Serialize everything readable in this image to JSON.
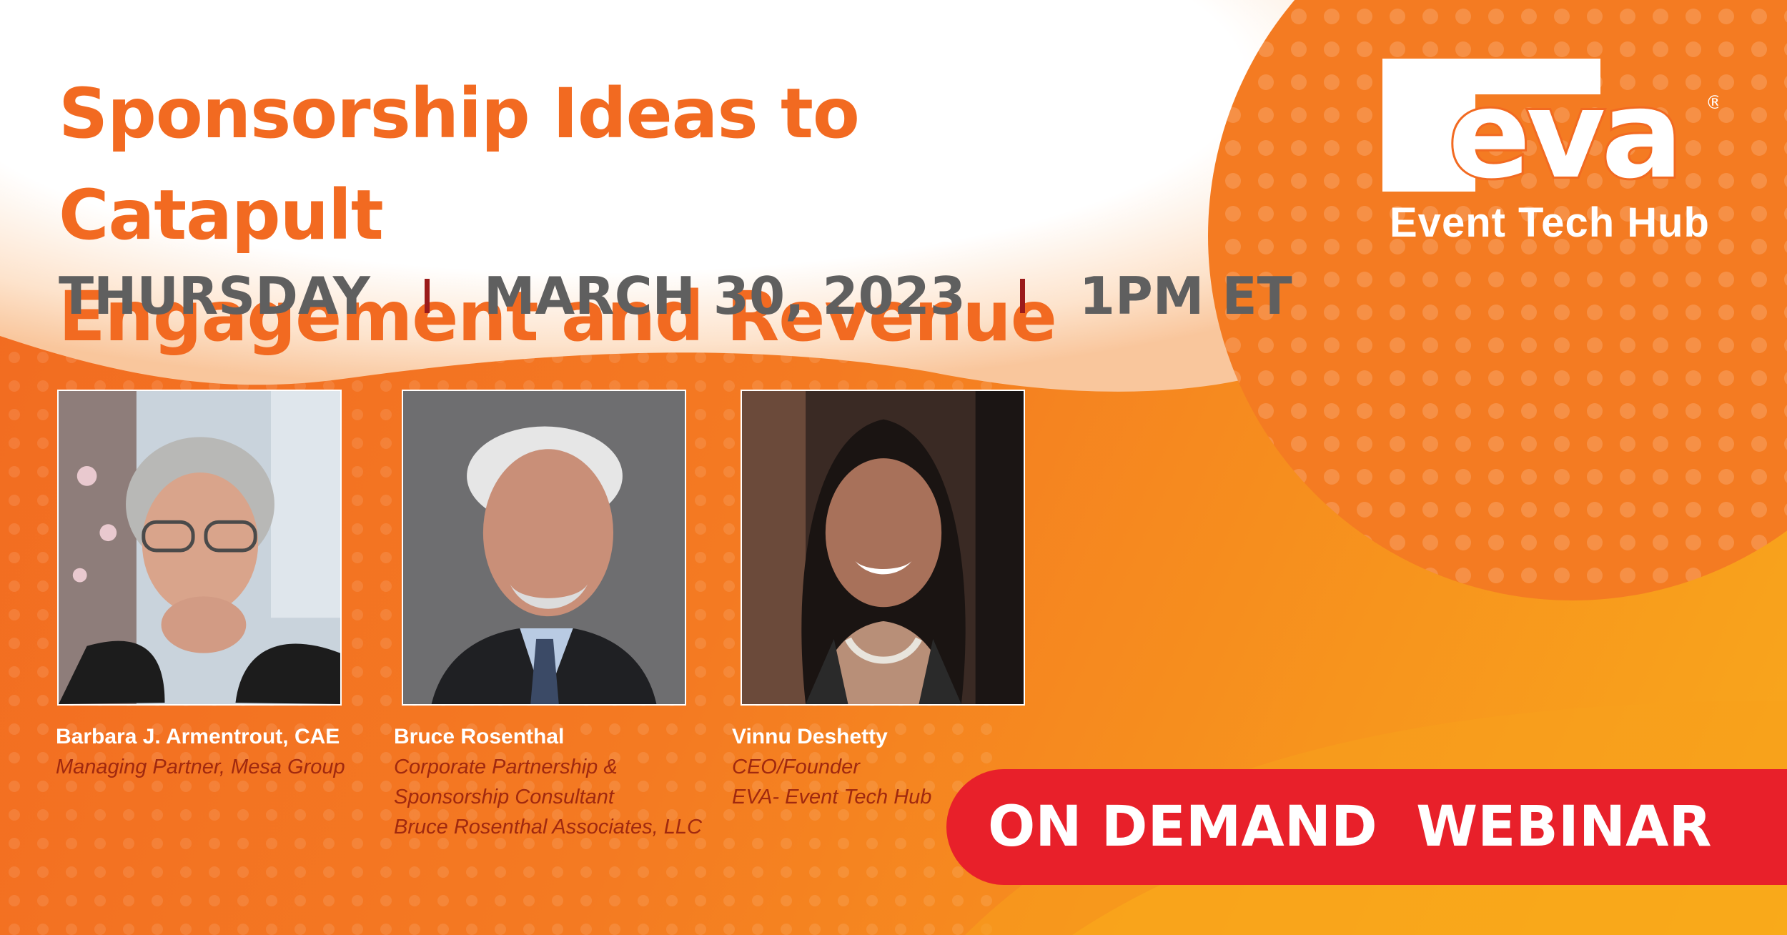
{
  "title": {
    "line1": "Sponsorship Ideas to Catapult",
    "line2": "Engagement and Revenue"
  },
  "event": {
    "day": "THURSDAY",
    "date": "MARCH 30, 2023",
    "time": "1PM ET"
  },
  "logo": {
    "mark": "eva",
    "registered": "®",
    "tagline": "Event Tech Hub"
  },
  "speakers": [
    {
      "name": "Barbara J. Armentrout, CAE",
      "role_lines": [
        "Managing Partner, Mesa Group"
      ]
    },
    {
      "name": "Bruce Rosenthal",
      "role_lines": [
        "Corporate Partnership &",
        "Sponsorship Consultant",
        "Bruce Rosenthal Associates, LLC"
      ]
    },
    {
      "name": "Vinnu Deshetty",
      "role_lines": [
        "CEO/Founder",
        "EVA- Event Tech Hub"
      ]
    }
  ],
  "badge": "ON DEMAND  WEBINAR",
  "colors": {
    "brand_orange": "#f26a21",
    "date_gray": "#5f5f5f",
    "separator_red": "#9b1b1b",
    "role_text": "#a0290f",
    "badge_red": "#e8202a"
  }
}
